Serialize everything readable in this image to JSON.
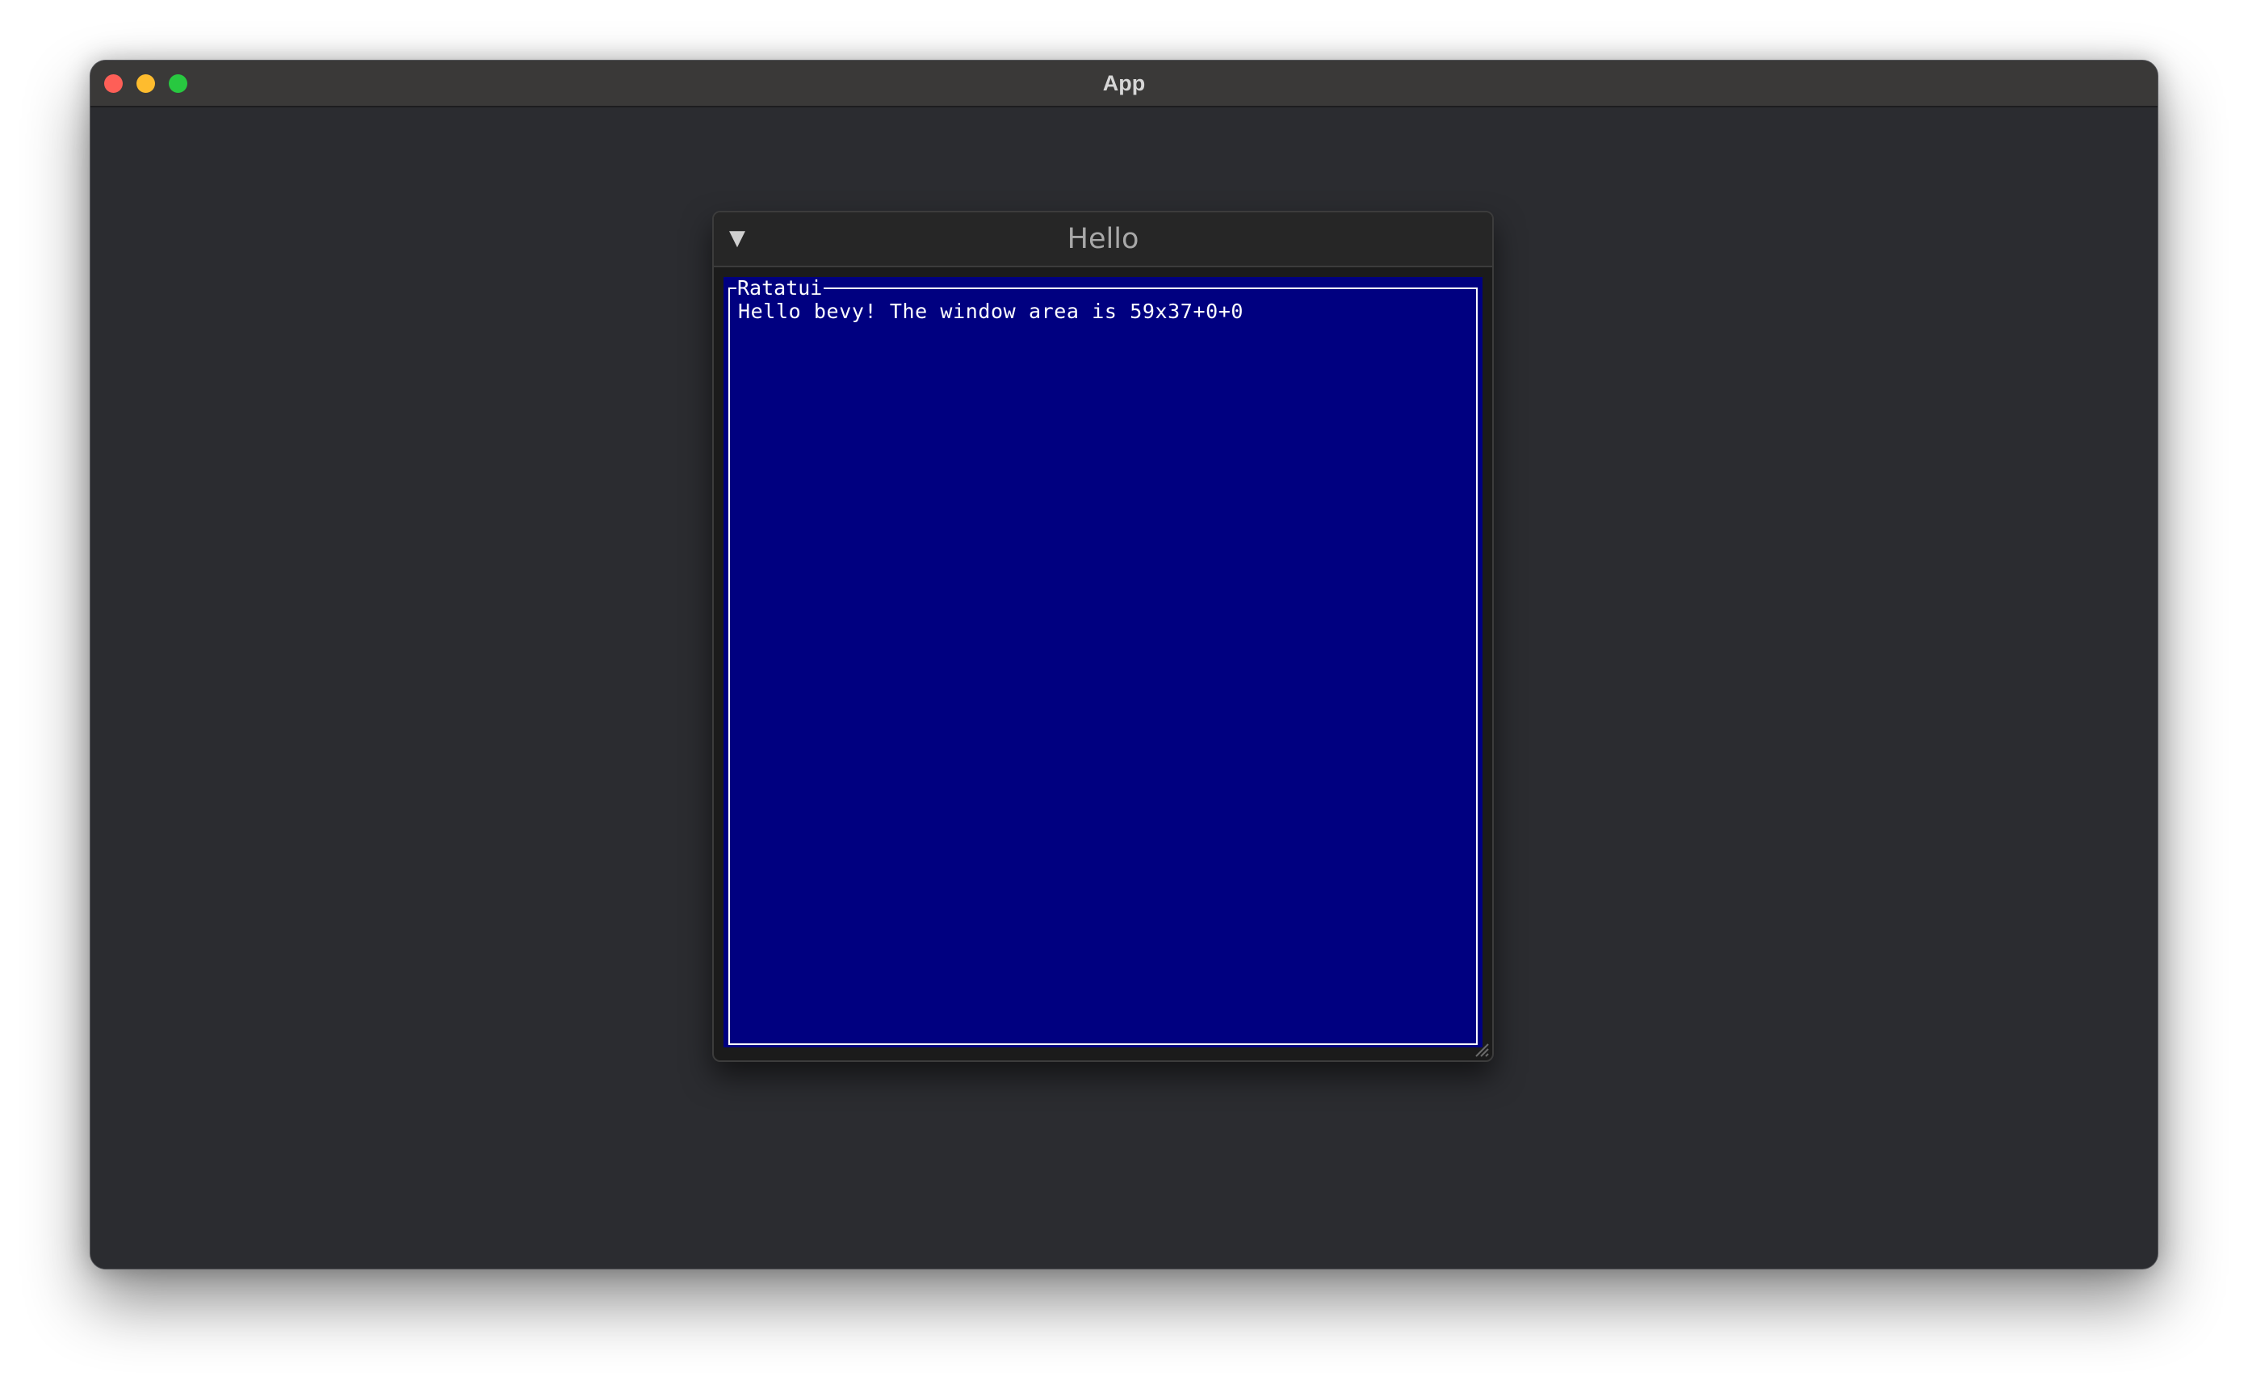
{
  "window": {
    "title": "App"
  },
  "egui_window": {
    "title": "Hello",
    "collapse_glyph": "▼"
  },
  "terminal": {
    "block_title": "Ratatui",
    "text": "Hello bevy! The window area is 59x37+0+0",
    "background_color": "#000080",
    "foreground_color": "#ffffff"
  },
  "colors": {
    "app_background": "#2b2c30",
    "titlebar": "#3a3938",
    "traffic_close": "#fe5f57",
    "traffic_minimize": "#febc2e",
    "traffic_zoom": "#28c840"
  },
  "icons": {
    "collapse": "chevron-down-icon",
    "resize": "resize-grip-icon"
  }
}
